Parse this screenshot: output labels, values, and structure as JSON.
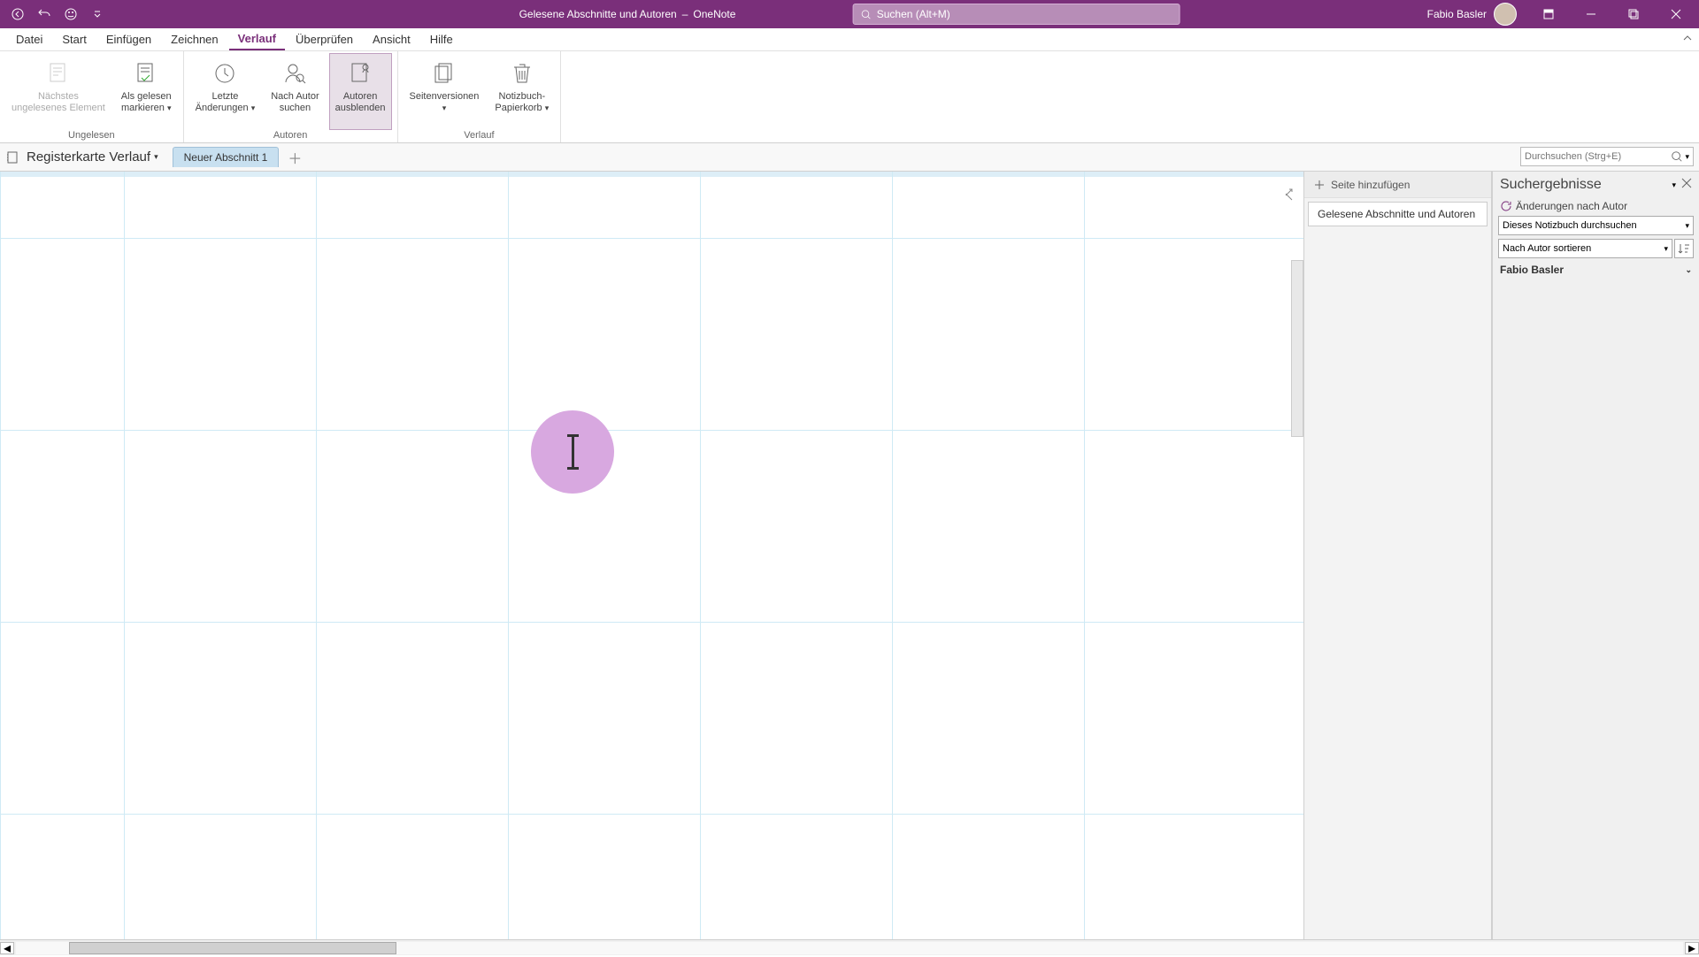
{
  "title_bar": {
    "doc_title": "Gelesene Abschnitte und Autoren",
    "separator": "–",
    "app_name": "OneNote",
    "search_placeholder": "Suchen (Alt+M)",
    "user_name": "Fabio Basler"
  },
  "menu": {
    "datei": "Datei",
    "start": "Start",
    "einfuegen": "Einfügen",
    "zeichnen": "Zeichnen",
    "verlauf": "Verlauf",
    "ueberpruefen": "Überprüfen",
    "ansicht": "Ansicht",
    "hilfe": "Hilfe"
  },
  "ribbon": {
    "naechstes_l1": "Nächstes",
    "naechstes_l2": "ungelesenes Element",
    "als_gelesen_l1": "Als gelesen",
    "als_gelesen_l2": "markieren",
    "group_ungelesen": "Ungelesen",
    "letzte_l1": "Letzte",
    "letzte_l2": "Änderungen",
    "nach_autor_l1": "Nach Autor",
    "nach_autor_l2": "suchen",
    "autoren_l1": "Autoren",
    "autoren_l2": "ausblenden",
    "group_autoren": "Autoren",
    "seitenversionen": "Seitenversionen",
    "papierkorb_l1": "Notizbuch-",
    "papierkorb_l2": "Papierkorb",
    "group_verlauf": "Verlauf"
  },
  "nav": {
    "notebook_name": "Registerkarte Verlauf",
    "section_tab": "Neuer Abschnitt 1",
    "search_placeholder": "Durchsuchen (Strg+E)"
  },
  "page_pane": {
    "add_page": "Seite hinzufügen",
    "page1": "Gelesene Abschnitte und Autoren"
  },
  "search_pane": {
    "title": "Suchergebnisse",
    "changes_by_author": "Änderungen nach Autor",
    "scope": "Dieses Notizbuch durchsuchen",
    "sort": "Nach Autor sortieren",
    "author1": "Fabio Basler"
  }
}
